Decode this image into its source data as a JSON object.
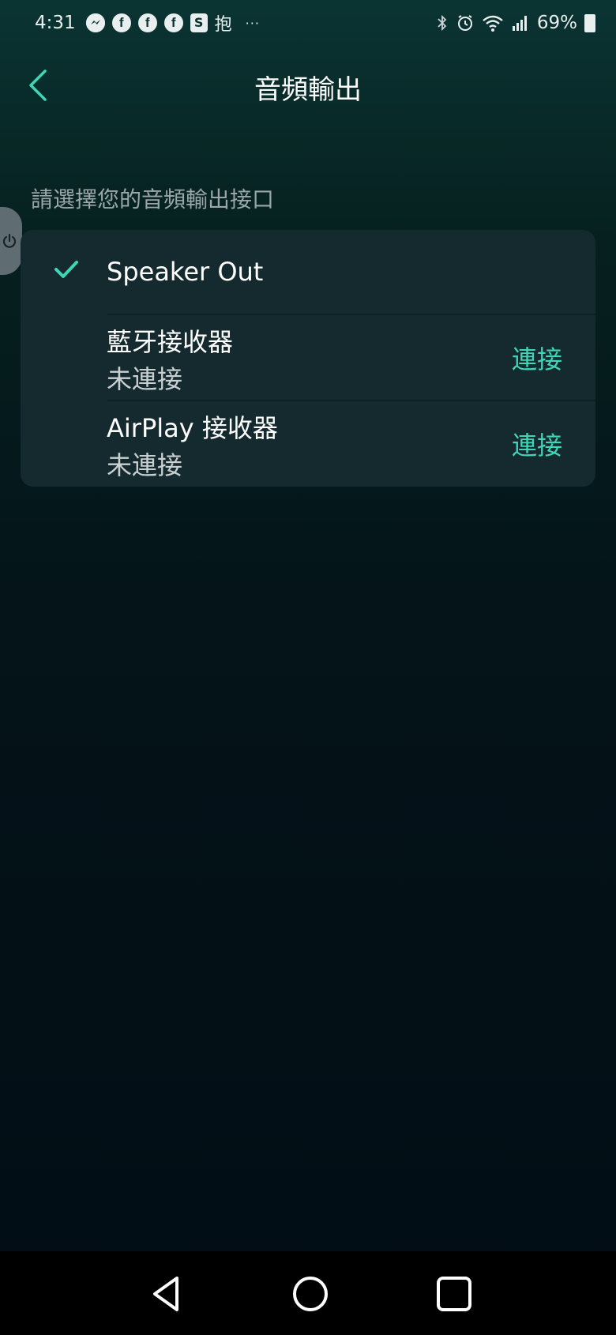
{
  "status_bar": {
    "time": "4:31",
    "notification_icons": [
      "messenger-icon",
      "facebook-icon",
      "facebook-icon",
      "facebook-icon",
      "shopping-bag-icon",
      "app-icon"
    ],
    "app_glyph": "抱",
    "more_indicator": "···",
    "system_icons": [
      "bluetooth-icon",
      "alarm-icon",
      "wifi-icon",
      "signal-icon",
      "battery-icon"
    ],
    "battery_percent": "69%"
  },
  "header": {
    "title": "音頻輸出",
    "back_icon": "chevron-left-icon"
  },
  "section_label": "請選擇您的音頻輸出接口",
  "outputs": [
    {
      "title": "Speaker Out",
      "selected": true
    },
    {
      "title": "藍牙接收器",
      "status": "未連接",
      "action": "連接"
    },
    {
      "title": "AirPlay 接收器",
      "status": "未連接",
      "action": "連接"
    }
  ],
  "colors": {
    "accent": "#3ed6b6",
    "card_background": "#152a2f",
    "secondary_text": "#9aa6a8"
  },
  "nav_bar": {
    "buttons": [
      "back-triangle-icon",
      "home-circle-icon",
      "recents-square-icon"
    ]
  }
}
